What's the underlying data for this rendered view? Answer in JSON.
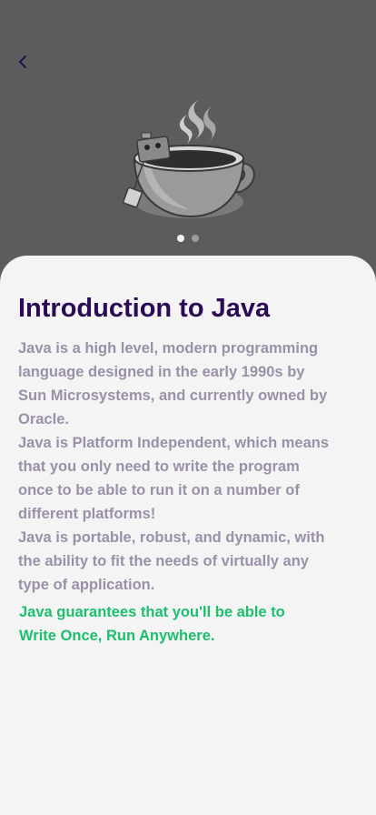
{
  "nav": {
    "back_icon": "chevron-left-icon"
  },
  "hero": {
    "image": "java-coffee-cup-illustration"
  },
  "pager": {
    "total": 2,
    "active_index": 0
  },
  "content": {
    "title": "Introduction to Java",
    "paragraphs": [
      "Java is a high level, modern programming language designed in the early 1990s by Sun Microsystems, and currently owned by Oracle.",
      "Java is Platform Independent, which means that you only need to write the program once to be able to run it on a number of different platforms!",
      "Java is portable, robust, and dynamic, with the ability to fit the needs of virtually any type of application."
    ],
    "highlight_lines": [
      "Java guarantees that you'll be able to",
      "Write Once, Run Anywhere."
    ]
  },
  "colors": {
    "overlay": "#5c5c5c",
    "sheet": "#f4f4f4",
    "title": "#2c0b55",
    "body": "#9a91a8",
    "accent": "#1cbf6d"
  }
}
